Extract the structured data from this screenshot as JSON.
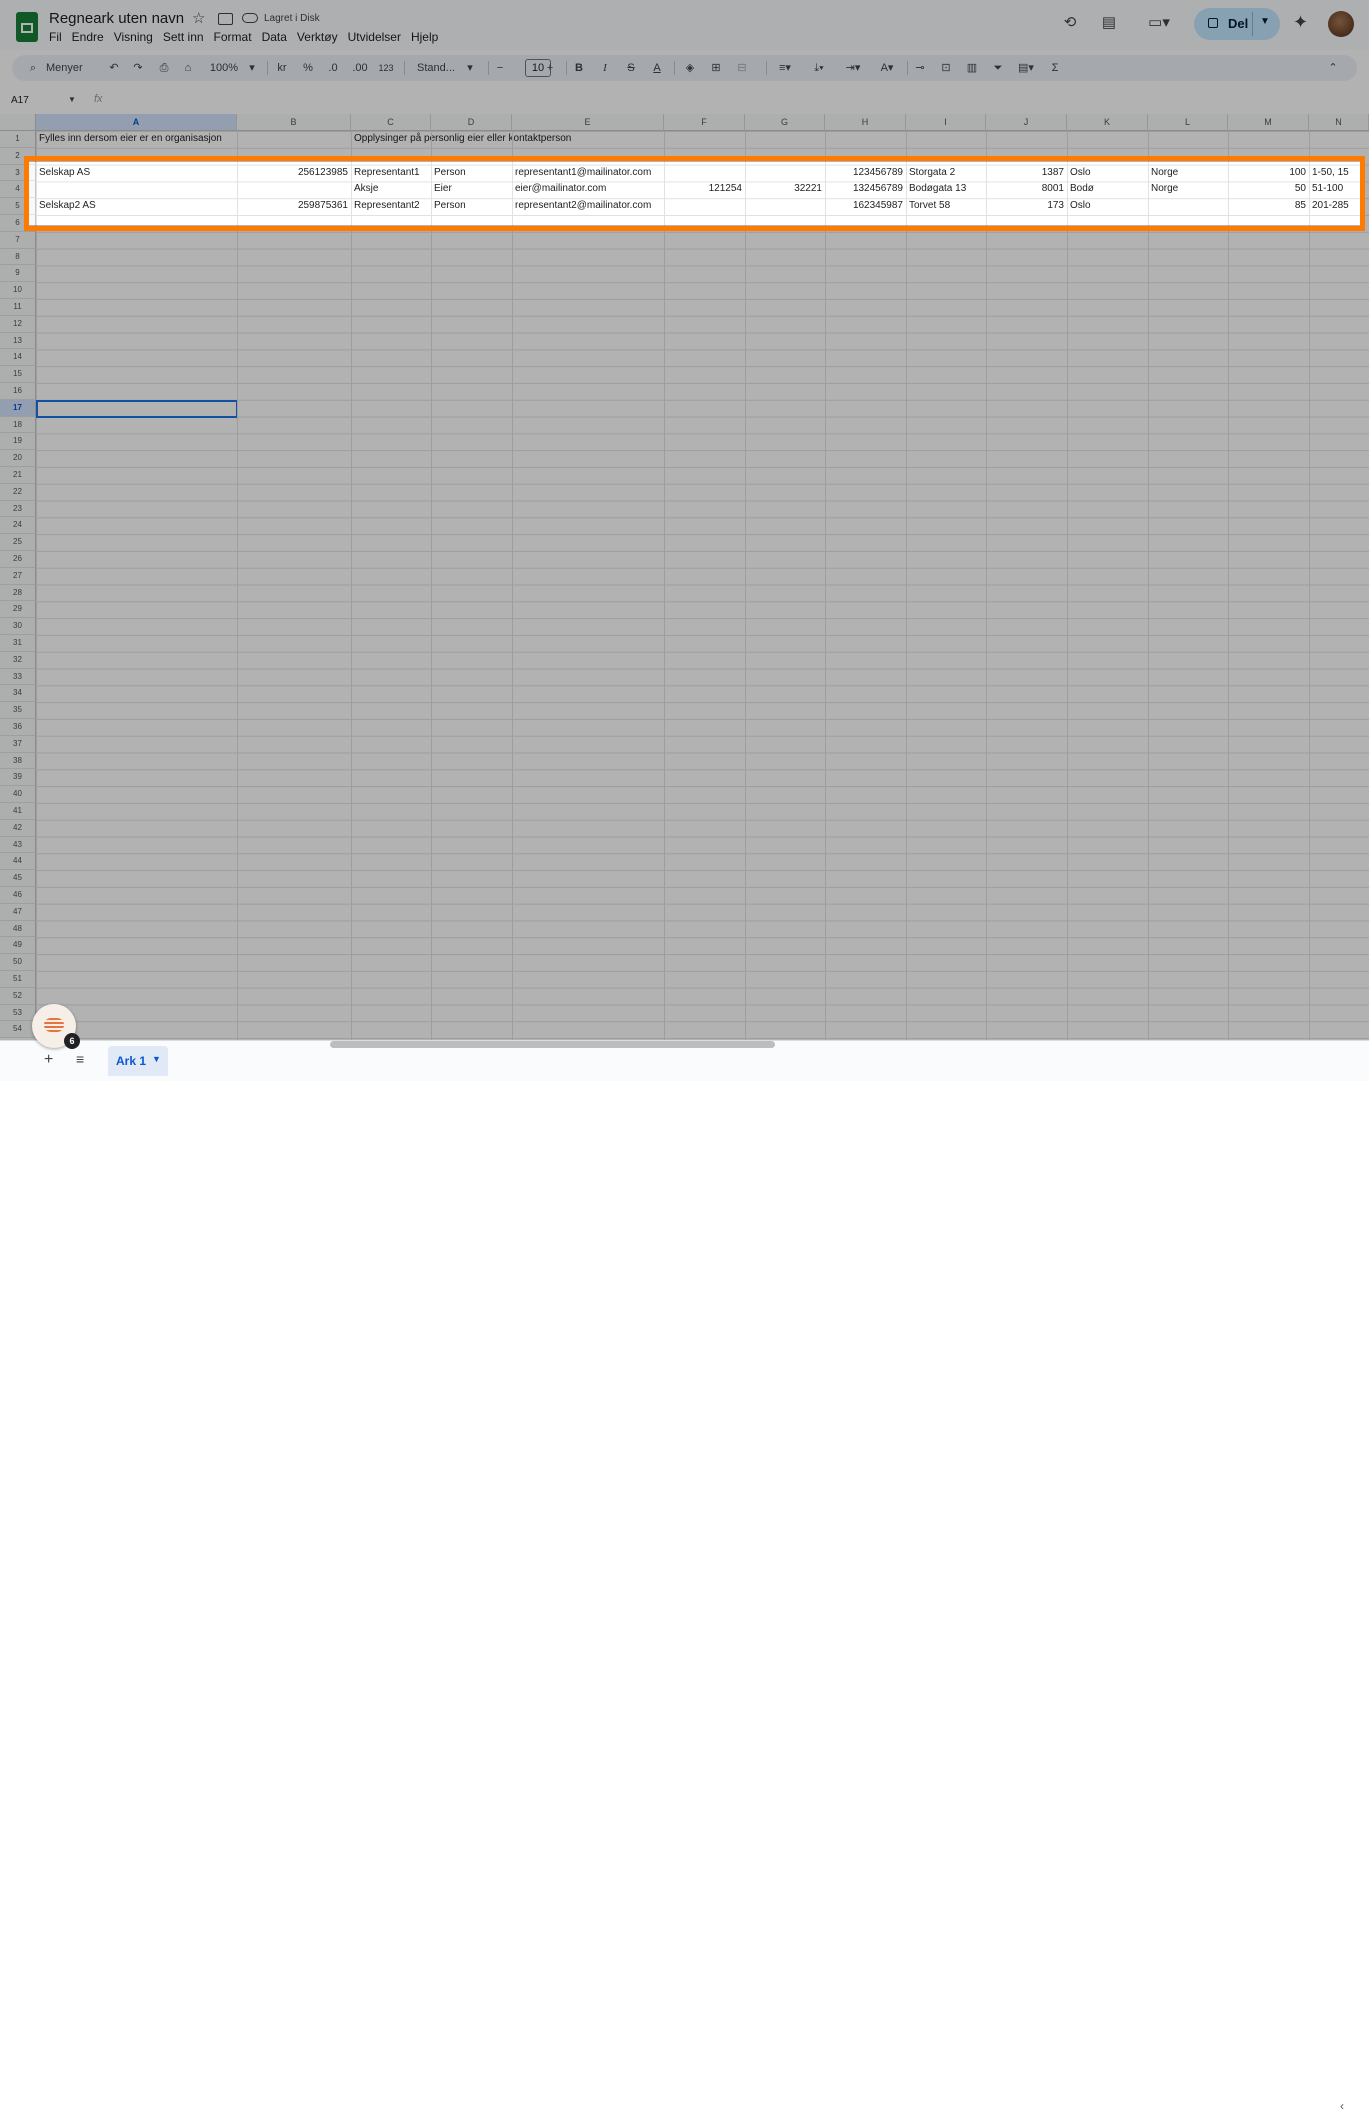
{
  "doc": {
    "title": "Regneark uten navn",
    "saved_status": "Lagret i Disk",
    "menu": [
      "Fil",
      "Endre",
      "Visning",
      "Sett inn",
      "Format",
      "Data",
      "Verktøy",
      "Utvidelser",
      "Hjelp"
    ],
    "share_label": "Del"
  },
  "toolbar": {
    "search_label": "Menyer",
    "zoom": "100%",
    "currency": "kr",
    "percent": "%",
    "decrease_decimals": ".0",
    "increase_decimals": ".00",
    "number_format": "123",
    "font": "Stand...",
    "font_size": "10",
    "bold": "B",
    "italic": "I",
    "strike": "S",
    "text_color": "A",
    "sum": "Σ"
  },
  "formula_bar": {
    "name_box": "A17",
    "fx": "fx"
  },
  "columns": [
    "A",
    "B",
    "C",
    "D",
    "E",
    "F",
    "G",
    "H",
    "I",
    "J",
    "K",
    "L",
    "M",
    "N"
  ],
  "selected_column": "A",
  "selected_row": "17",
  "row_count": 54,
  "cells": {
    "r1": {
      "A": "Fylles inn dersom eier er en organisasjon",
      "C": "Opplysinger på personlig eier eller kontaktperson"
    },
    "r3": {
      "A": "Selskap AS",
      "B": "256123985",
      "C": "Representant1",
      "D": "Person",
      "E": "representant1@mailinator.com",
      "H": "123456789",
      "I": "Storgata 2",
      "J": "1387",
      "K": "Oslo",
      "L": "Norge",
      "M": "100",
      "N": "1-50, 15"
    },
    "r4": {
      "C": "Aksje",
      "D": "Eier",
      "E": "eier@mailinator.com",
      "F": "121254",
      "G": "32221",
      "H": "132456789",
      "I": "Bodøgata 13",
      "J": "8001",
      "K": "Bodø",
      "L": "Norge",
      "M": "50",
      "N": "51-100"
    },
    "r5": {
      "A": "Selskap2 AS",
      "B": "259875361",
      "C": "Representant2",
      "D": "Person",
      "E": "representant2@mailinator.com",
      "H": "162345987",
      "I": "Torvet 58",
      "J": "173",
      "K": "Oslo",
      "M": "85",
      "N": "201-285"
    }
  },
  "sheet_tab": "Ark 1",
  "explore_badge": "6"
}
